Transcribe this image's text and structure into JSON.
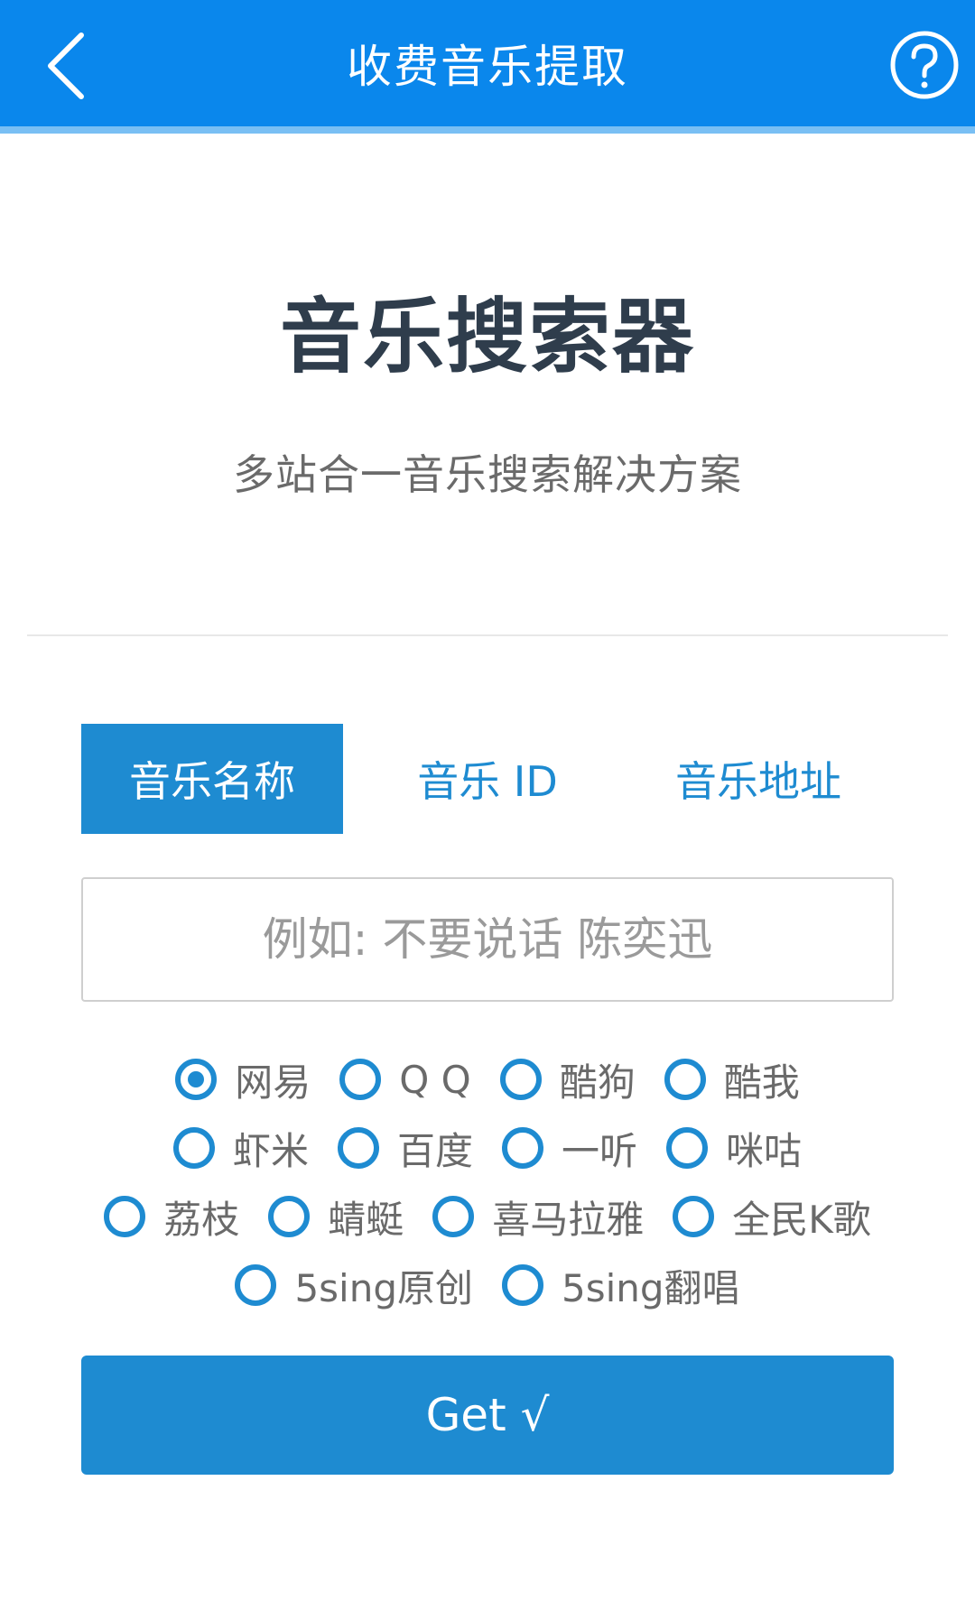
{
  "header": {
    "title": "收费音乐提取",
    "back_icon": "chevron-left-icon",
    "help_icon": "question-circle-icon"
  },
  "hero": {
    "title": "音乐搜索器",
    "subtitle": "多站合一音乐搜索解决方案"
  },
  "tabs": [
    {
      "label": "音乐名称",
      "active": true
    },
    {
      "label": "音乐 ID",
      "active": false
    },
    {
      "label": "音乐地址",
      "active": false
    }
  ],
  "search": {
    "value": "",
    "placeholder": "例如: 不要说话 陈奕迅"
  },
  "sources": {
    "selected": "网易",
    "rows": [
      [
        "网易",
        "Q Q",
        "酷狗",
        "酷我"
      ],
      [
        "虾米",
        "百度",
        "一听",
        "咪咕"
      ],
      [
        "荔枝",
        "蜻蜓",
        "喜马拉雅",
        "全民K歌"
      ],
      [
        "5sing原创",
        "5sing翻唱"
      ]
    ]
  },
  "action": {
    "get_label": "Get √"
  },
  "colors": {
    "header_bg": "#0a87ec",
    "accent": "#1e8bd1",
    "title_text": "#2f3d4c"
  }
}
